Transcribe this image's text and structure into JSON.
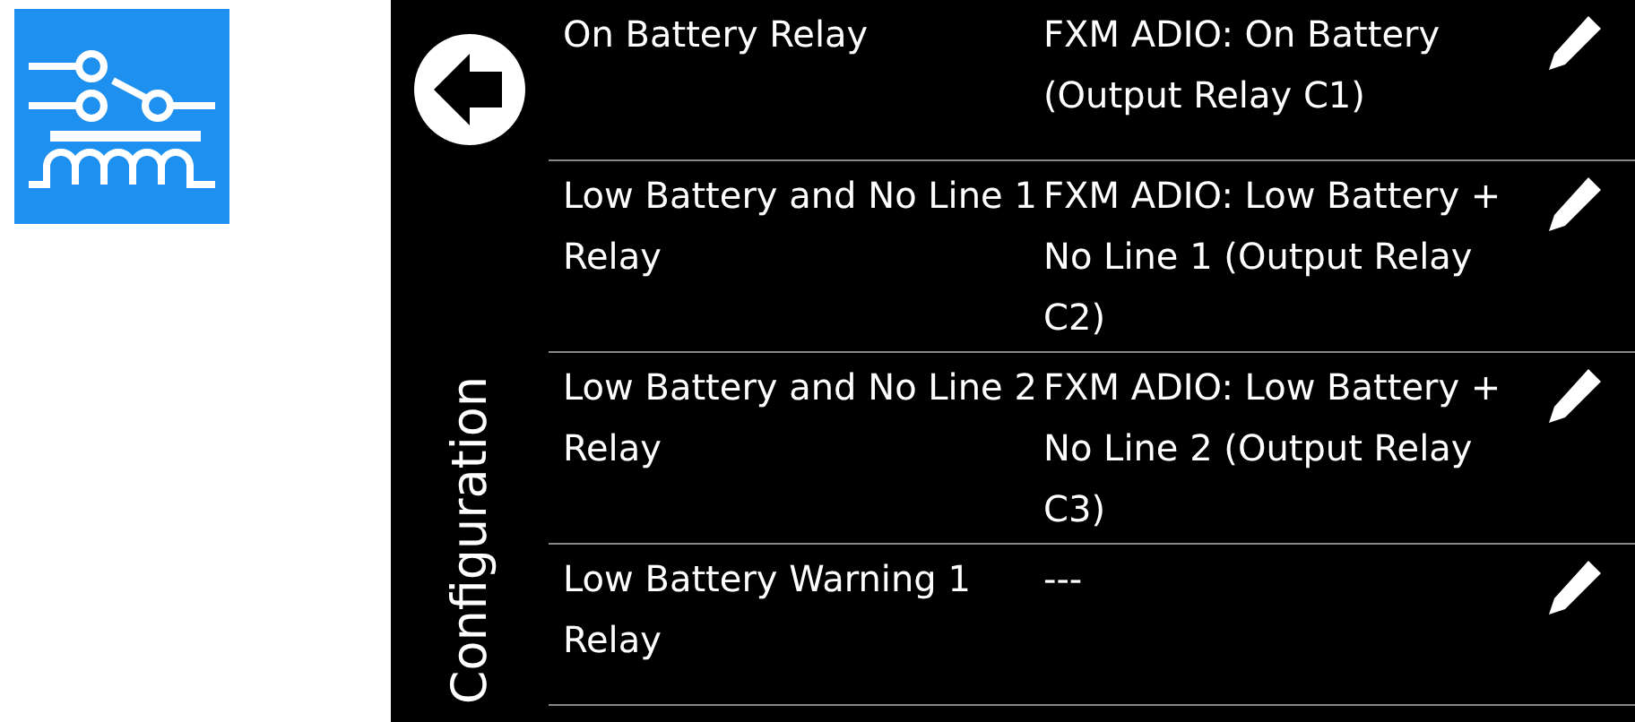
{
  "side_title": "Configuration",
  "rows": [
    {
      "label": "On Battery Relay",
      "value": "FXM ADIO: On Battery (Output Relay C1)"
    },
    {
      "label": "Low Battery and No Line 1 Relay",
      "value": "FXM ADIO: Low Battery + No Line 1 (Output Relay C2)"
    },
    {
      "label": "Low Battery and No Line 2 Relay",
      "value": "FXM ADIO: Low Battery + No Line 2 (Output Relay C3)"
    },
    {
      "label": "Low Battery Warning 1 Relay",
      "value": "---"
    }
  ]
}
